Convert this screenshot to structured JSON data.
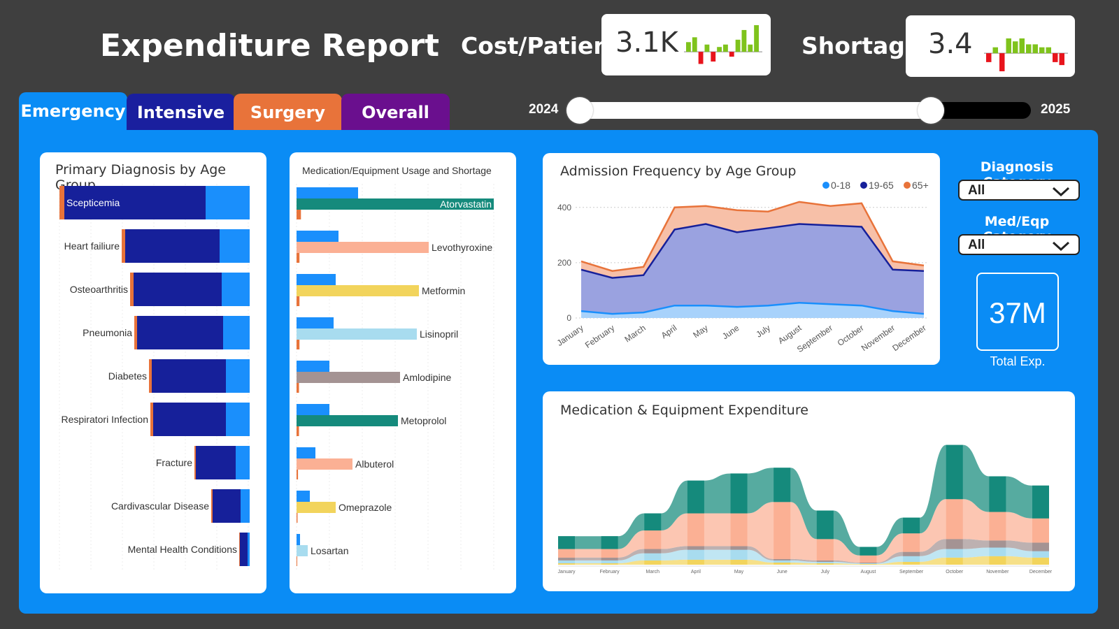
{
  "header": {
    "title": "Expenditure Report",
    "kpis": [
      {
        "label": "Cost/Patient",
        "value": "3.1K"
      },
      {
        "label": "Shortage",
        "value": "3.4"
      }
    ]
  },
  "tabs": [
    {
      "label": "Emergency",
      "color": "#0a8cf5"
    },
    {
      "label": "Intensive",
      "color": "#1a1f9e"
    },
    {
      "label": "Surgery",
      "color": "#e8733a"
    },
    {
      "label": "Overall",
      "color": "#6a0f8e"
    }
  ],
  "year_slider": {
    "start": "2024",
    "end": "2025"
  },
  "diagnosis_panel": {
    "title": "Primary Diagnosis by Age Group",
    "rows": [
      {
        "label": "Scepticemia"
      },
      {
        "label": "Heart failiure"
      },
      {
        "label": "Osteoarthritis"
      },
      {
        "label": "Pneumonia"
      },
      {
        "label": "Diabetes"
      },
      {
        "label": "Respiratori Infection"
      },
      {
        "label": "Fracture"
      },
      {
        "label": "Cardivascular Disease"
      },
      {
        "label": "Mental Health Conditions"
      }
    ]
  },
  "medication_panel": {
    "title": "Medication/Equipment Usage and Shortage",
    "rows": [
      {
        "label": "Atorvastatin"
      },
      {
        "label": "Levothyroxine"
      },
      {
        "label": "Metformin"
      },
      {
        "label": "Lisinopril"
      },
      {
        "label": "Amlodipine"
      },
      {
        "label": "Metoprolol"
      },
      {
        "label": "Albuterol"
      },
      {
        "label": "Omeprazole"
      },
      {
        "label": "Losartan"
      }
    ]
  },
  "admission_panel": {
    "title": "Admission Frequency by Age Group",
    "legend": [
      "0-18",
      "19-65",
      "65+"
    ],
    "y_ticks": [
      "400",
      "200",
      "0"
    ],
    "months": [
      "January",
      "February",
      "March",
      "April",
      "May",
      "June",
      "July",
      "August",
      "September",
      "October",
      "November",
      "December"
    ]
  },
  "slicers": {
    "diagnosis": {
      "label": "Diagnosis Category",
      "value": "All"
    },
    "med_eqp": {
      "label": "Med/Eqp Category",
      "value": "All"
    }
  },
  "total": {
    "value": "37M",
    "label": "Total Exp."
  },
  "expenditure_panel": {
    "title": "Medication & Equipment Expenditure",
    "months": [
      "January",
      "February",
      "March",
      "April",
      "May",
      "June",
      "July",
      "August",
      "September",
      "October",
      "November",
      "December"
    ]
  },
  "chart_data": [
    {
      "type": "bar",
      "title": "Primary Diagnosis by Age Group",
      "categories": [
        "Scepticemia",
        "Heart failiure",
        "Osteoarthritis",
        "Pneumonia",
        "Diabetes",
        "Respiratori Infection",
        "Fracture",
        "Cardivascular Disease",
        "Mental Health Conditions"
      ],
      "series": [
        {
          "name": "0-18",
          "values": [
            63,
            43,
            40,
            38,
            34,
            34,
            20,
            13,
            3
          ]
        },
        {
          "name": "19-65",
          "values": [
            202,
            135,
            126,
            123,
            106,
            104,
            57,
            40,
            11
          ]
        },
        {
          "name": "65+",
          "values": [
            7,
            5,
            5,
            4,
            4,
            4,
            2,
            2,
            1
          ]
        }
      ],
      "colors": [
        "#1a8ffc",
        "#16209a",
        "#e8733a"
      ]
    },
    {
      "type": "bar",
      "title": "Medication/Equipment Usage and Shortage",
      "categories": [
        "Atorvastatin",
        "Levothyroxine",
        "Metformin",
        "Lisinopril",
        "Amlodipine",
        "Metoprolol",
        "Albuterol",
        "Omeprazole",
        "Losartan"
      ],
      "series": [
        {
          "values": [
            88,
            60,
            56,
            53,
            47,
            47,
            27,
            19,
            5
          ]
        },
        {
          "values": [
            282,
            189,
            175,
            172,
            148,
            145,
            80,
            56,
            16
          ]
        },
        {
          "values": [
            9,
            6,
            6,
            6,
            5,
            5,
            3,
            2,
            1
          ]
        }
      ],
      "bar_colors": [
        "#158a7c",
        "#fbb094",
        "#f2d45c",
        "#a8dcef",
        "#a49393",
        "#158a7c",
        "#fbb094",
        "#f2d45c",
        "#a8dcef"
      ]
    },
    {
      "type": "area",
      "title": "Admission Frequency by Age Group",
      "categories": [
        "January",
        "February",
        "March",
        "April",
        "May",
        "June",
        "July",
        "August",
        "September",
        "October",
        "November",
        "December"
      ],
      "ylim": [
        0,
        450
      ],
      "series": [
        {
          "name": "0-18",
          "values": [
            25,
            15,
            20,
            45,
            45,
            40,
            45,
            55,
            50,
            45,
            25,
            15
          ],
          "color": "#1a8ffc"
        },
        {
          "name": "19-65",
          "values": [
            150,
            130,
            135,
            275,
            295,
            270,
            280,
            285,
            285,
            285,
            150,
            155
          ],
          "color": "#16209a"
        },
        {
          "name": "65+",
          "values": [
            30,
            25,
            30,
            80,
            65,
            80,
            60,
            80,
            70,
            85,
            30,
            20
          ],
          "color": "#e8733a"
        }
      ]
    },
    {
      "type": "area",
      "title": "Medication & Equipment Expenditure",
      "categories": [
        "January",
        "February",
        "March",
        "April",
        "May",
        "June",
        "July",
        "August",
        "September",
        "October",
        "November",
        "December"
      ],
      "series": [
        {
          "values": [
            2,
            2,
            6,
            7,
            7,
            3,
            2,
            1,
            4,
            10,
            12,
            10
          ],
          "color": "#f2d45c"
        },
        {
          "values": [
            4,
            4,
            10,
            14,
            14,
            3,
            2,
            1,
            8,
            12,
            12,
            9
          ],
          "color": "#a8dcef"
        },
        {
          "values": [
            4,
            4,
            6,
            5,
            5,
            2,
            2,
            1,
            6,
            14,
            10,
            12
          ],
          "color": "#a49393"
        },
        {
          "values": [
            12,
            12,
            26,
            46,
            46,
            80,
            30,
            10,
            26,
            56,
            40,
            34
          ],
          "color": "#fbb094"
        },
        {
          "values": [
            18,
            18,
            24,
            46,
            56,
            48,
            40,
            12,
            22,
            76,
            50,
            46
          ],
          "color": "#158a7c"
        }
      ]
    }
  ],
  "sparklines": {
    "cost": [
      4,
      6,
      -5,
      3,
      -4,
      2,
      3,
      -2,
      5,
      9,
      3,
      11
    ],
    "shortage": [
      -3,
      2,
      -9,
      5,
      4,
      5,
      3,
      3,
      2,
      2,
      -3,
      -4
    ]
  },
  "colors": {
    "background": "#3f3f3f",
    "main_panel": "#0a8cf5"
  }
}
